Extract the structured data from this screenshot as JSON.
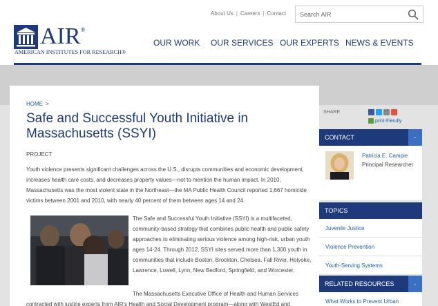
{
  "utility_nav": {
    "about": "About Us",
    "careers": "Careers",
    "contact": "Contact",
    "separator": "|"
  },
  "search": {
    "placeholder": "Search AIR"
  },
  "logo": {
    "brand": "AIR",
    "registered": "®",
    "tagline": "American Institutes for Research®"
  },
  "main_nav": {
    "items": [
      "OUR WORK",
      "OUR SERVICES",
      "OUR EXPERTS",
      "NEWS & EVENTS"
    ]
  },
  "breadcrumb": {
    "home": "HOME",
    "arrow": ">"
  },
  "article": {
    "title": "Safe and Successful Youth Initiative in Massachusetts (SSYI)",
    "label": "PROJECT",
    "para1": "Youth violence presents significant challenges across the U.S., disrupts communities and economic development, increases health care costs, and decreases property values—not to mention the human impact. In 2010, Massachusetts was the most violent state in the Northeast—the MA Public Health Council reported 1,667 homicide victims between 2001 and 2010, with nearly 40 percent of them between ages 14 and 24.",
    "para2": "The Safe and Successful Youth Initiative (SSYI) is a multifaceted, community-based strategy that combines public health and public safety approaches to eliminating serious violence among high-risk, urban youth ages 14-24. Through 2012, SSYI sites served more than 1,300 youth in communities that include Boston, Brockton, Chelsea, Fall River, Holyoke, Lawrence, Lowell, Lynn, New Bedford, Springfield, and Worcester.",
    "para3_start": "The Massachusetts Executive Office of Health and Human Services",
    "para3_cont": "contracted with justice experts from AIR's Health and Social Development program—along with WestEd and"
  },
  "sidebar": {
    "share_label": "SHARE",
    "print_label": "print-friendly",
    "contact": {
      "heading": "CONTACT",
      "toggle": "-",
      "name": "Patricia E. Campie",
      "role": "Principal Researcher"
    },
    "topics": {
      "heading": "TOPICS",
      "items": [
        "Juvenile Justice",
        "Violence Prevention",
        "Youth-Serving Systems"
      ]
    },
    "related": {
      "heading": "RELATED RESOURCES",
      "toggle": "-",
      "items": [
        "What Works to Prevent Urban"
      ]
    }
  },
  "colors": {
    "brand_navy": "#1f3a7a",
    "link_blue": "#1f5fa8",
    "toggle_blue": "#3a6fc4",
    "facebook": "#3b5998",
    "twitter": "#1da1f2",
    "email": "#888888",
    "plus": "#e0533a",
    "print": "#5a9e3a"
  }
}
